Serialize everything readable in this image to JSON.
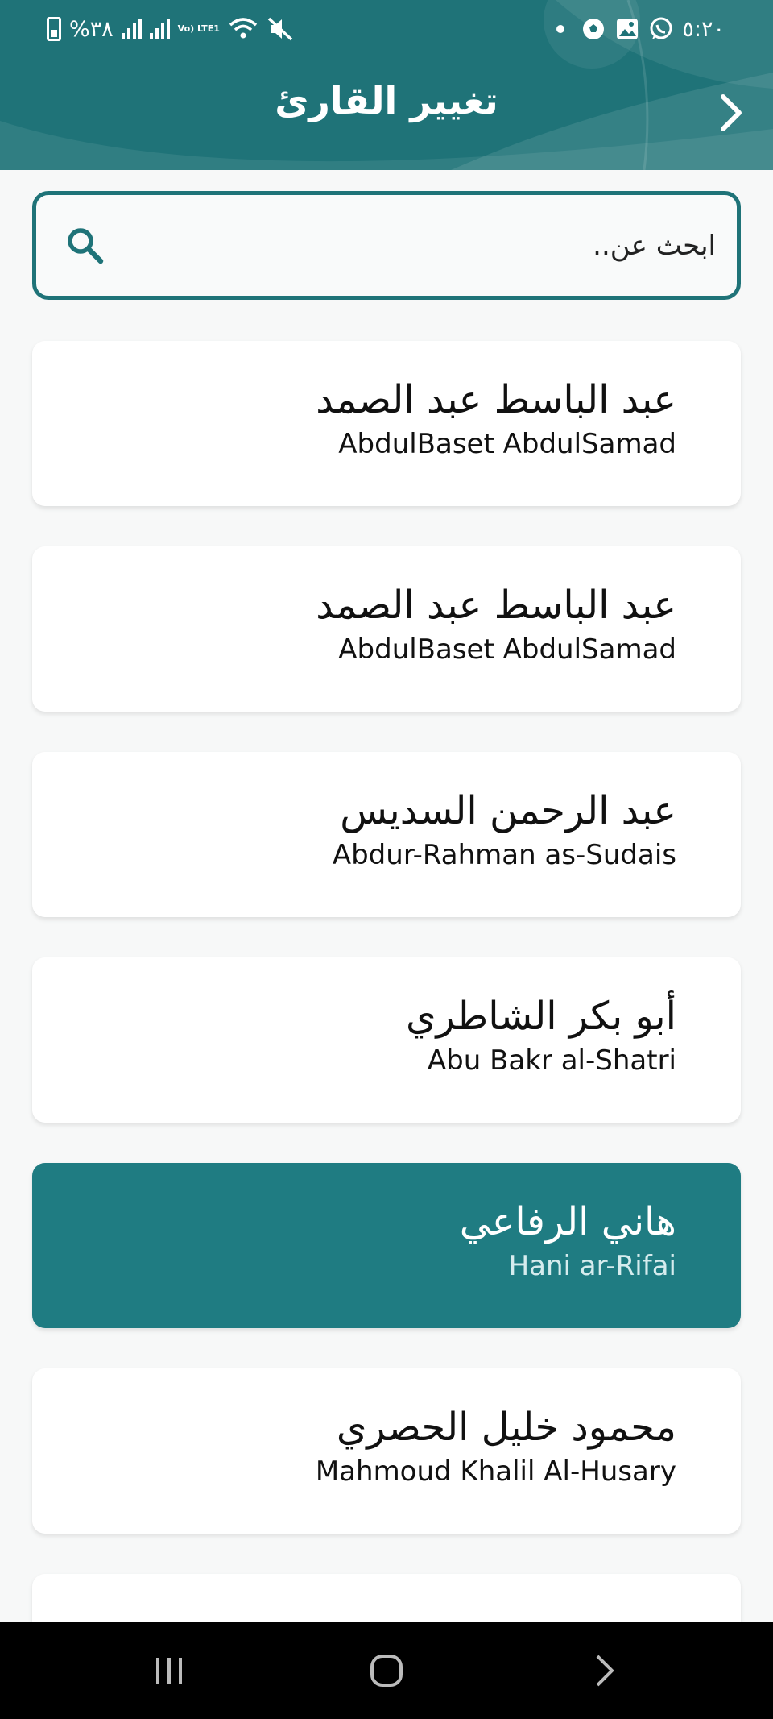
{
  "status_bar": {
    "battery": "%٣٨",
    "lte": "Vo) LTE1",
    "time": "٥:٢٠"
  },
  "header": {
    "title": "تغيير القارئ",
    "back_icon": "chevron-right-icon"
  },
  "search": {
    "placeholder": "ابحث عن..",
    "icon": "search-icon"
  },
  "reciters": [
    {
      "arabic": "عبد الباسط عبد الصمد",
      "english": "AbdulBaset AbdulSamad",
      "selected": false
    },
    {
      "arabic": "عبد الباسط عبد الصمد",
      "english": "AbdulBaset AbdulSamad",
      "selected": false
    },
    {
      "arabic": "عبد الرحمن السديس",
      "english": "Abdur-Rahman as-Sudais",
      "selected": false
    },
    {
      "arabic": "أبو بكر الشاطري",
      "english": "Abu Bakr al-Shatri",
      "selected": false
    },
    {
      "arabic": "هاني الرفاعي",
      "english": "Hani ar-Rifai",
      "selected": true
    },
    {
      "arabic": "محمود خليل الحصري",
      "english": "Mahmoud Khalil Al-Husary",
      "selected": false
    }
  ],
  "colors": {
    "primary": "#1f7378",
    "selected_card": "#1f7c82",
    "background": "#f7f8f8"
  },
  "nav": {
    "recents_icon": "recents-icon",
    "home_icon": "home-icon",
    "back_icon": "back-icon"
  }
}
